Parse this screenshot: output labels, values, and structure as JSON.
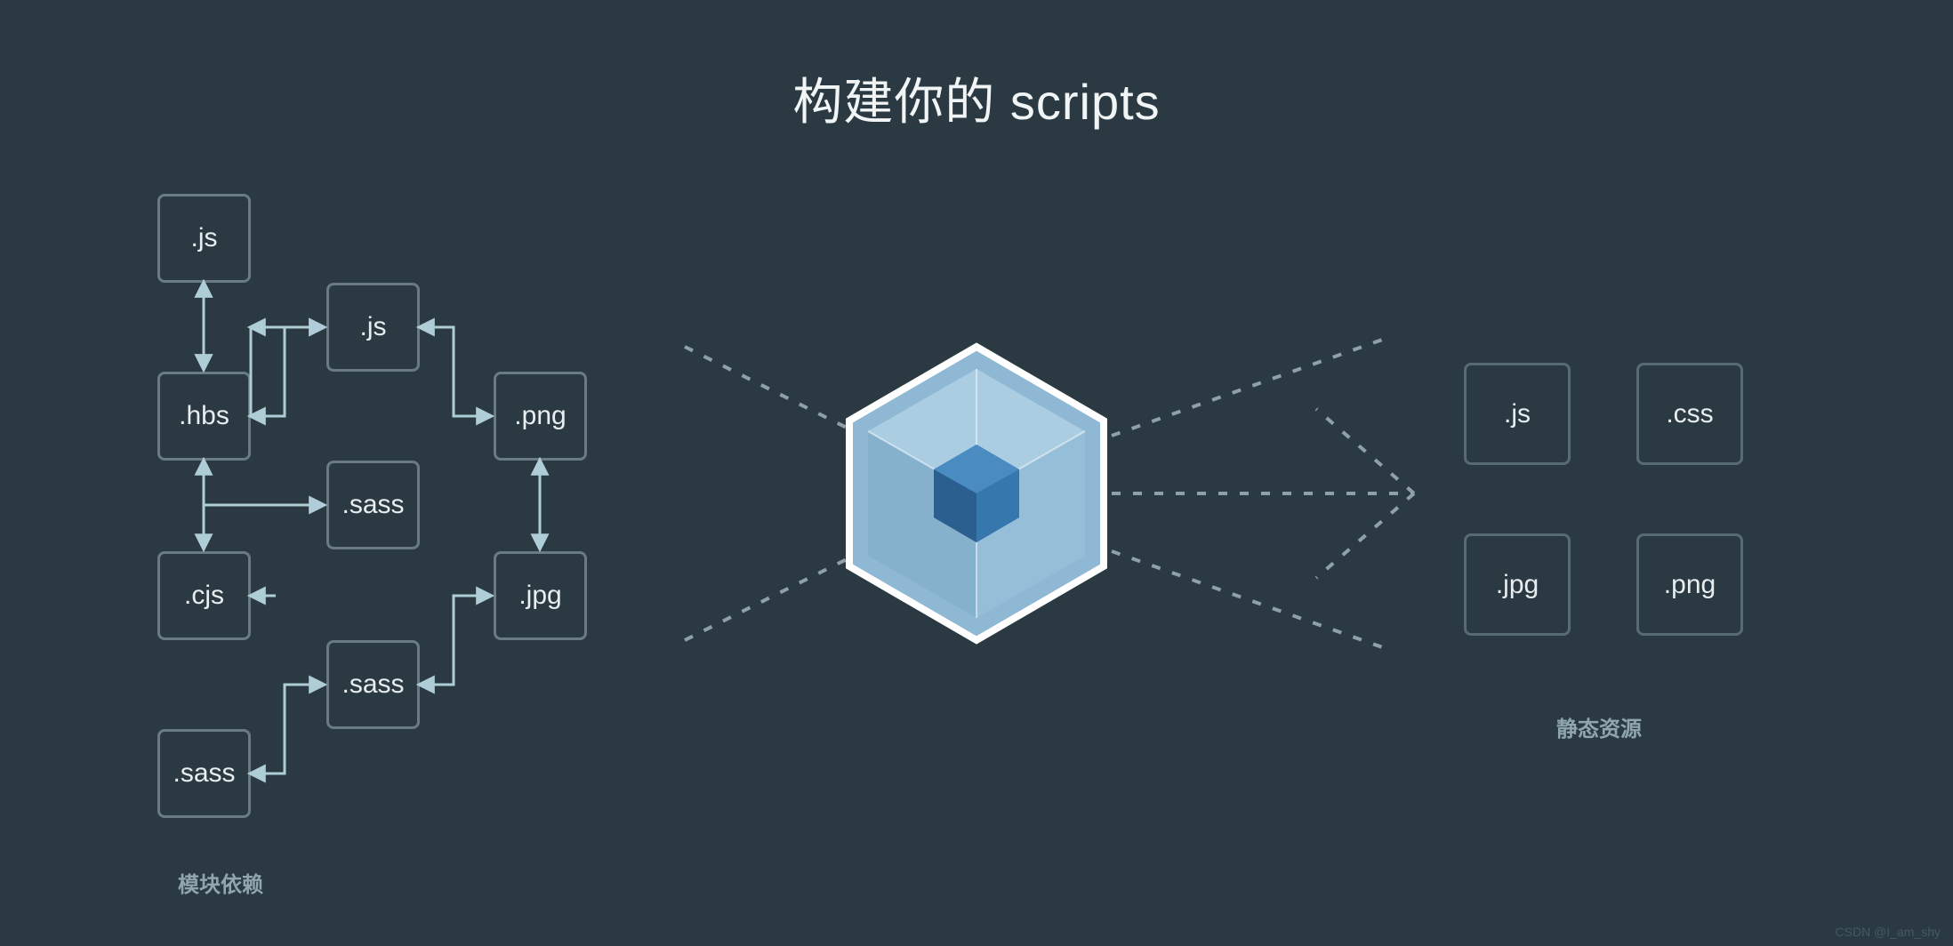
{
  "title": "构建你的 scripts",
  "left_label": "模块依赖",
  "right_label": "静态资源",
  "watermark": "CSDN @I_am_shy",
  "left_nodes": {
    "js1": ".js",
    "js2": ".js",
    "hbs": ".hbs",
    "png": ".png",
    "sass1": ".sass",
    "cjs": ".cjs",
    "jpg": ".jpg",
    "sass2": ".sass",
    "sass3": ".sass"
  },
  "right_nodes": {
    "js": ".js",
    "css": ".css",
    "jpg": ".jpg",
    "png": ".png"
  }
}
